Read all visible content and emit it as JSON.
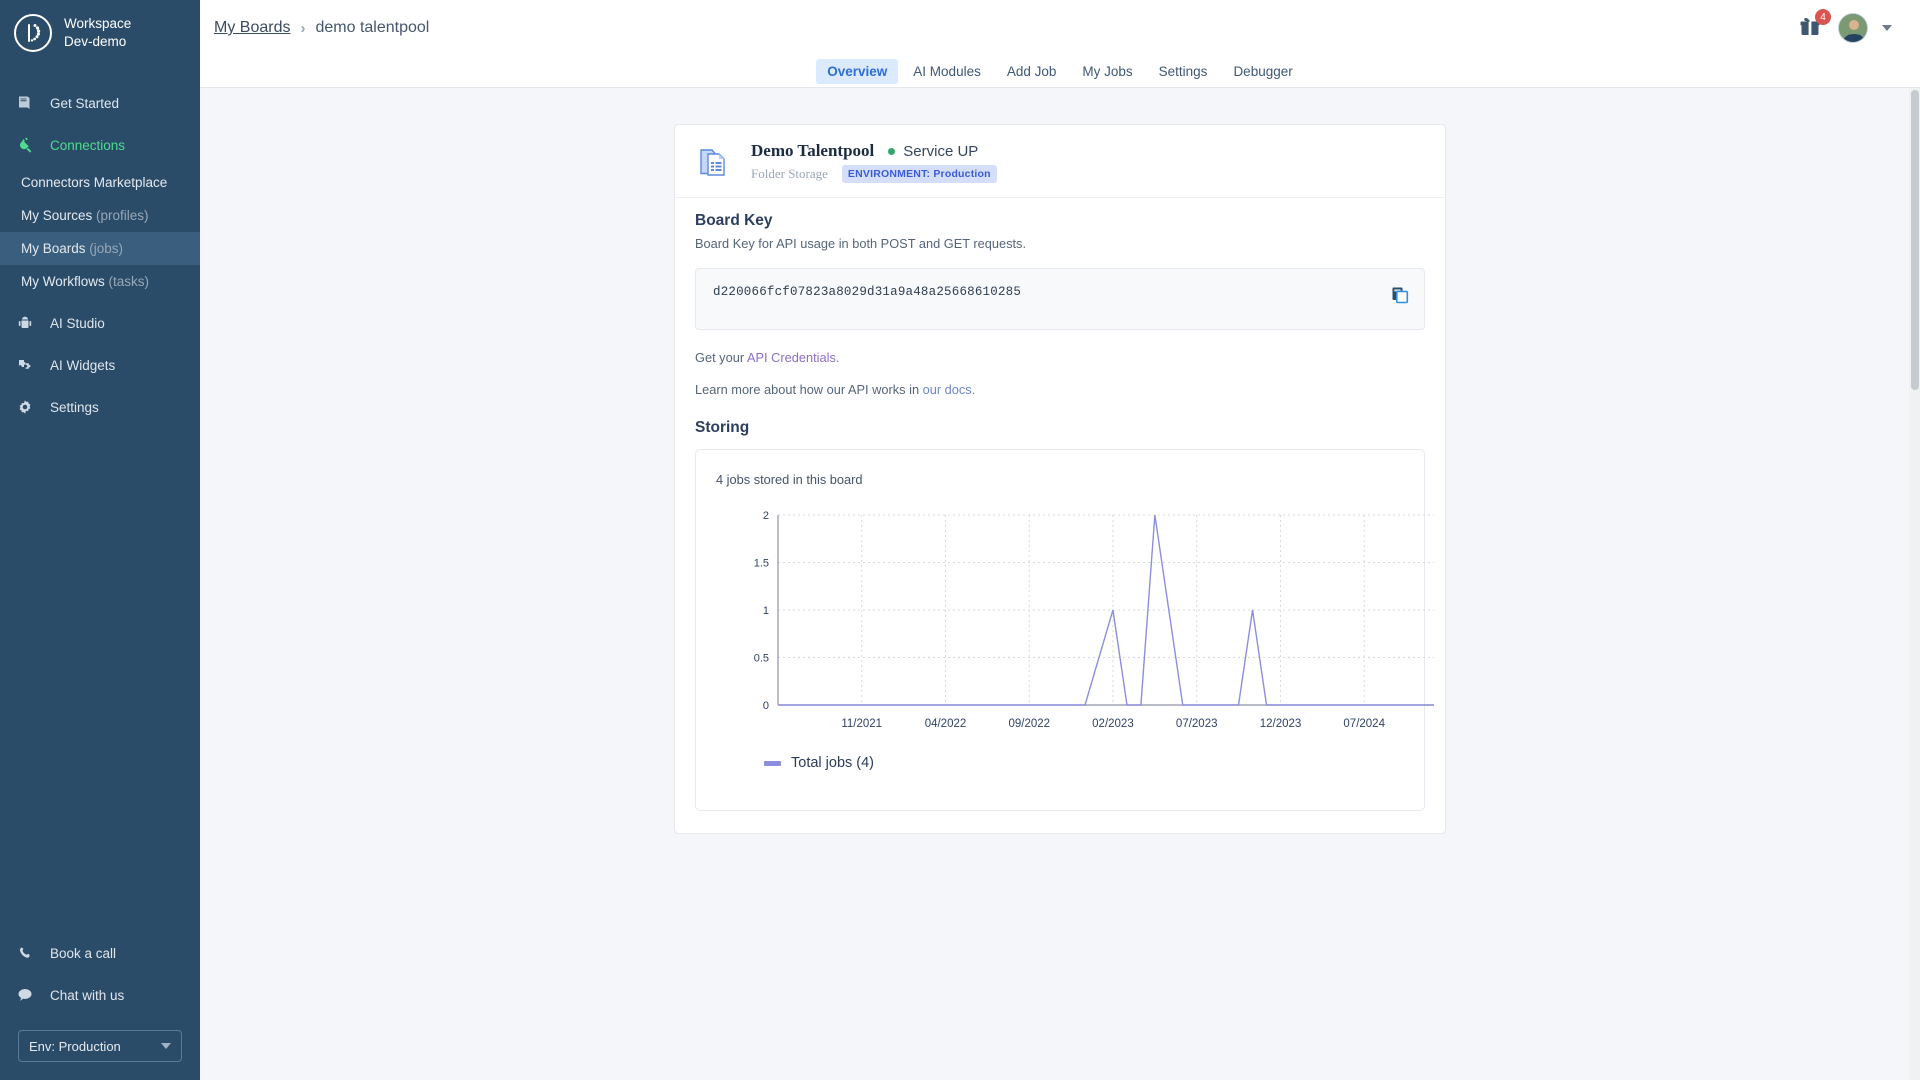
{
  "sidebar": {
    "workspace_label": "Workspace",
    "workspace_name": "Dev-demo",
    "logo_icon": "dotted-d-logo-icon",
    "nav": [
      {
        "label": "Get Started",
        "icon": "book-icon"
      },
      {
        "label": "Connections",
        "icon": "plug-icon"
      }
    ],
    "subnav": [
      {
        "label": "Connectors Marketplace",
        "suffix": ""
      },
      {
        "label": "My Sources ",
        "suffix": "(profiles)"
      },
      {
        "label": "My Boards ",
        "suffix": "(jobs)"
      },
      {
        "label": "My Workflows ",
        "suffix": "(tasks)"
      }
    ],
    "nav2": [
      {
        "label": "AI Studio",
        "icon": "robot-icon"
      },
      {
        "label": "AI Widgets",
        "icon": "puzzle-icon"
      },
      {
        "label": "Settings",
        "icon": "gear-icon"
      }
    ],
    "bottom": [
      {
        "label": "Book a call",
        "icon": "phone-icon"
      },
      {
        "label": "Chat with us",
        "icon": "chat-bubble-icon"
      }
    ],
    "env_selector": "Env: Production"
  },
  "topbar": {
    "breadcrumb_root": "My Boards",
    "breadcrumb_sep": "›",
    "breadcrumb_current": "demo talentpool",
    "gift_icon": "gift-icon",
    "notification_count": "4",
    "avatar_icon": "user-avatar",
    "avatar_caret": "chevron-down-icon"
  },
  "tabs": [
    {
      "label": "Overview",
      "active": true
    },
    {
      "label": "AI Modules",
      "active": false
    },
    {
      "label": "Add Job",
      "active": false
    },
    {
      "label": "My Jobs",
      "active": false
    },
    {
      "label": "Settings",
      "active": false
    },
    {
      "label": "Debugger",
      "active": false
    }
  ],
  "card": {
    "icon": "folder-document-icon",
    "title": "Demo Talentpool",
    "status": "Service UP",
    "status_color": "#35a76a",
    "subtitle": "Folder Storage",
    "environment_tag": "ENVIRONMENT: Production",
    "board_key_heading": "Board Key",
    "board_key_desc": "Board Key for API usage in both POST and GET requests.",
    "board_key_value": "d220066fcf07823a8029d31a9a48a25668610285",
    "copy_icon": "copy-icon",
    "credentials_prefix": "Get your ",
    "credentials_link": "API Credentials.",
    "docs_prefix": "Learn more about how our API works in ",
    "docs_link": "our docs.",
    "storing_heading": "Storing",
    "chart_caption": "4 jobs stored in this board"
  },
  "chart_data": {
    "type": "line",
    "title": "",
    "xlabel": "",
    "ylabel": "",
    "legend": [
      {
        "name": "Total jobs (4)",
        "color": "#8c8ede"
      }
    ],
    "legend_position": "bottom-left",
    "grid": true,
    "ylim": [
      0,
      2
    ],
    "yticks": [
      "0",
      "0.5",
      "1",
      "1.5",
      "2"
    ],
    "ytick_values": [
      0,
      0.5,
      1,
      1.5,
      2
    ],
    "xticks": [
      "11/2021",
      "04/2022",
      "09/2022",
      "02/2023",
      "07/2023",
      "12/2023",
      "07/2024"
    ],
    "xtick_positions": [
      0.1276,
      0.2553,
      0.383,
      0.5106,
      0.6383,
      0.766,
      0.8936
    ],
    "series": [
      {
        "name": "Total jobs (4)",
        "color": "#8c8ede",
        "points": [
          {
            "x": 0.0,
            "y": 0
          },
          {
            "x": 0.468,
            "y": 0
          },
          {
            "x": 0.5106,
            "y": 1
          },
          {
            "x": 0.532,
            "y": 0
          },
          {
            "x": 0.5532,
            "y": 0
          },
          {
            "x": 0.5745,
            "y": 2
          },
          {
            "x": 0.617,
            "y": 0
          },
          {
            "x": 0.702,
            "y": 0
          },
          {
            "x": 0.7234,
            "y": 1
          },
          {
            "x": 0.7447,
            "y": 0
          },
          {
            "x": 1.0,
            "y": 0
          }
        ]
      }
    ]
  }
}
